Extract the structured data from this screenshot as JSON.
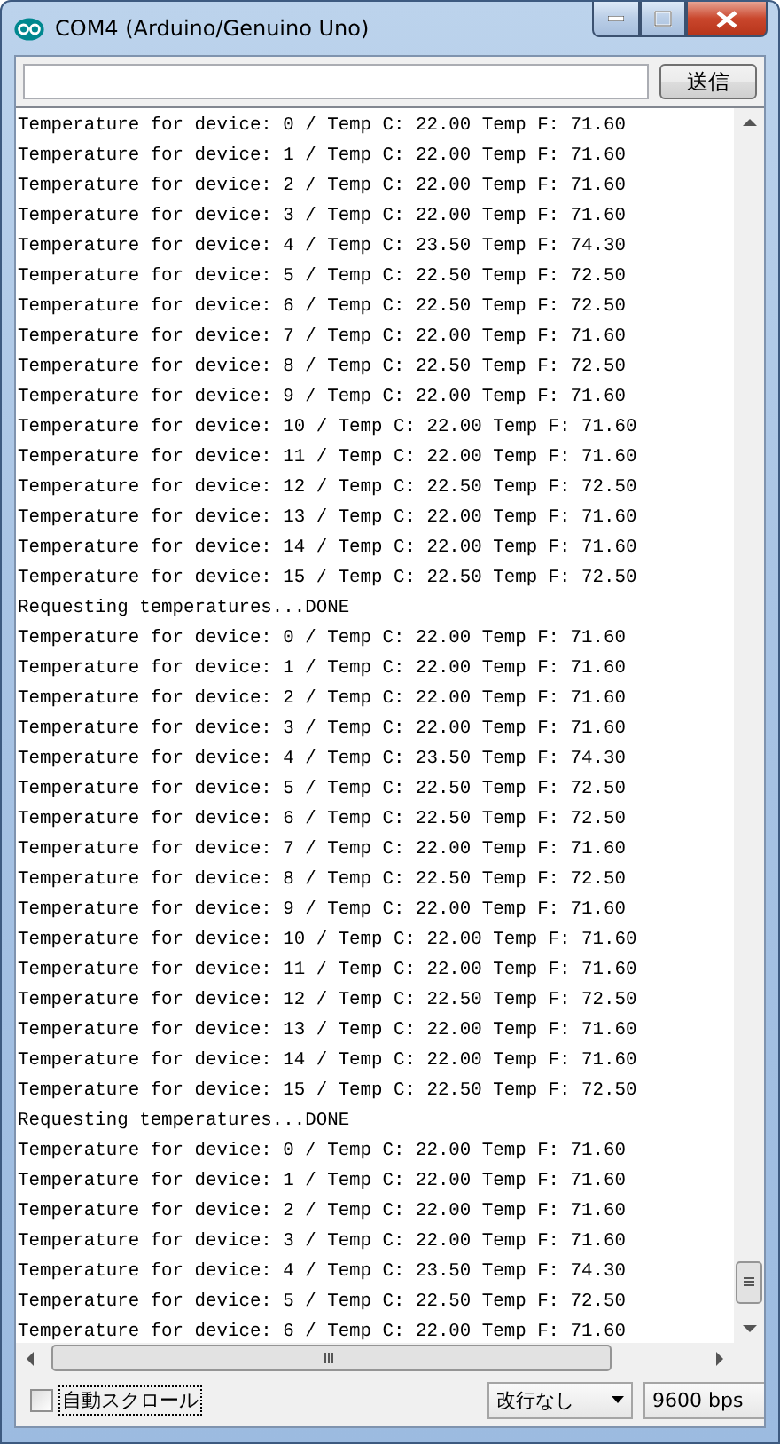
{
  "window": {
    "title": "COM4 (Arduino/Genuino Uno)"
  },
  "send_bar": {
    "button": "送信"
  },
  "output": {
    "lines": [
      "Temperature for device: 0 / Temp C: 22.00 Temp F: 71.60",
      "Temperature for device: 1 / Temp C: 22.00 Temp F: 71.60",
      "Temperature for device: 2 / Temp C: 22.00 Temp F: 71.60",
      "Temperature for device: 3 / Temp C: 22.00 Temp F: 71.60",
      "Temperature for device: 4 / Temp C: 23.50 Temp F: 74.30",
      "Temperature for device: 5 / Temp C: 22.50 Temp F: 72.50",
      "Temperature for device: 6 / Temp C: 22.50 Temp F: 72.50",
      "Temperature for device: 7 / Temp C: 22.00 Temp F: 71.60",
      "Temperature for device: 8 / Temp C: 22.50 Temp F: 72.50",
      "Temperature for device: 9 / Temp C: 22.00 Temp F: 71.60",
      "Temperature for device: 10 / Temp C: 22.00 Temp F: 71.60",
      "Temperature for device: 11 / Temp C: 22.00 Temp F: 71.60",
      "Temperature for device: 12 / Temp C: 22.50 Temp F: 72.50",
      "Temperature for device: 13 / Temp C: 22.00 Temp F: 71.60",
      "Temperature for device: 14 / Temp C: 22.00 Temp F: 71.60",
      "Temperature for device: 15 / Temp C: 22.50 Temp F: 72.50",
      "Requesting temperatures...DONE",
      "Temperature for device: 0 / Temp C: 22.00 Temp F: 71.60",
      "Temperature for device: 1 / Temp C: 22.00 Temp F: 71.60",
      "Temperature for device: 2 / Temp C: 22.00 Temp F: 71.60",
      "Temperature for device: 3 / Temp C: 22.00 Temp F: 71.60",
      "Temperature for device: 4 / Temp C: 23.50 Temp F: 74.30",
      "Temperature for device: 5 / Temp C: 22.50 Temp F: 72.50",
      "Temperature for device: 6 / Temp C: 22.50 Temp F: 72.50",
      "Temperature for device: 7 / Temp C: 22.00 Temp F: 71.60",
      "Temperature for device: 8 / Temp C: 22.50 Temp F: 72.50",
      "Temperature for device: 9 / Temp C: 22.00 Temp F: 71.60",
      "Temperature for device: 10 / Temp C: 22.00 Temp F: 71.60",
      "Temperature for device: 11 / Temp C: 22.00 Temp F: 71.60",
      "Temperature for device: 12 / Temp C: 22.50 Temp F: 72.50",
      "Temperature for device: 13 / Temp C: 22.00 Temp F: 71.60",
      "Temperature for device: 14 / Temp C: 22.00 Temp F: 71.60",
      "Temperature for device: 15 / Temp C: 22.50 Temp F: 72.50",
      "Requesting temperatures...DONE",
      "Temperature for device: 0 / Temp C: 22.00 Temp F: 71.60",
      "Temperature for device: 1 / Temp C: 22.00 Temp F: 71.60",
      "Temperature for device: 2 / Temp C: 22.00 Temp F: 71.60",
      "Temperature for device: 3 / Temp C: 22.00 Temp F: 71.60",
      "Temperature for device: 4 / Temp C: 23.50 Temp F: 74.30",
      "Temperature for device: 5 / Temp C: 22.50 Temp F: 72.50",
      "Temperature for device: 6 / Temp C: 22.00 Temp F: 71.60"
    ]
  },
  "status_bar": {
    "autoscroll": {
      "label": "自動スクロール",
      "checked": false
    },
    "line_ending": "改行なし",
    "baud_rate": "9600 bps"
  }
}
